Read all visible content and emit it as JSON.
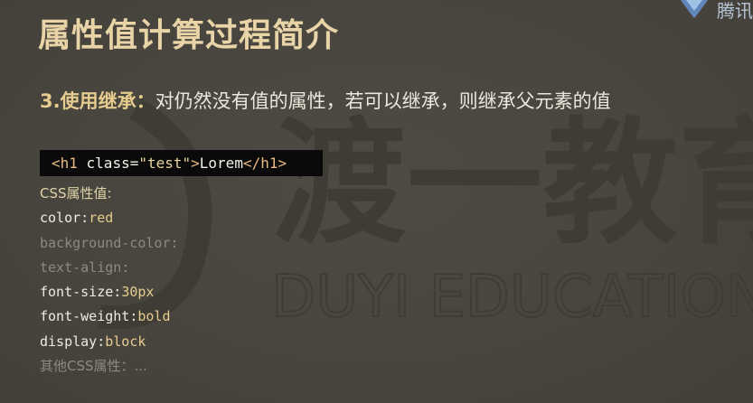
{
  "slide": {
    "title": "属性值计算过程简介",
    "logo_text": "腾讯",
    "subtitle_accent": "3.使用继承：",
    "subtitle_text": "对仍然没有值的属性，若可以继承，则继承父元素的值"
  },
  "code_sample": {
    "open_tag": "<h1",
    "attr": " class=",
    "attr_value": "\"test\"",
    "close_open": ">",
    "text": "Lorem",
    "end_tag": "</h1>"
  },
  "properties": {
    "header": "CSS属性值:",
    "items": [
      {
        "name": "color:",
        "value": "red"
      },
      {
        "name": "background-color:",
        "value": ""
      },
      {
        "name": "text-align:",
        "value": ""
      },
      {
        "name": "font-size:",
        "value": "30px"
      },
      {
        "name": "font-weight:",
        "value": "bold"
      },
      {
        "name": "display:",
        "value": "block"
      }
    ],
    "more": "其他CSS属性：..."
  },
  "watermark": {
    "cn": "渡一教育",
    "en": "DUYI EDUCATION"
  },
  "colors": {
    "background": "#4a4740",
    "title": "#e8d4a6",
    "accent": "#e6cc8e"
  },
  "icons": [
    "brand-logo-icon"
  ]
}
